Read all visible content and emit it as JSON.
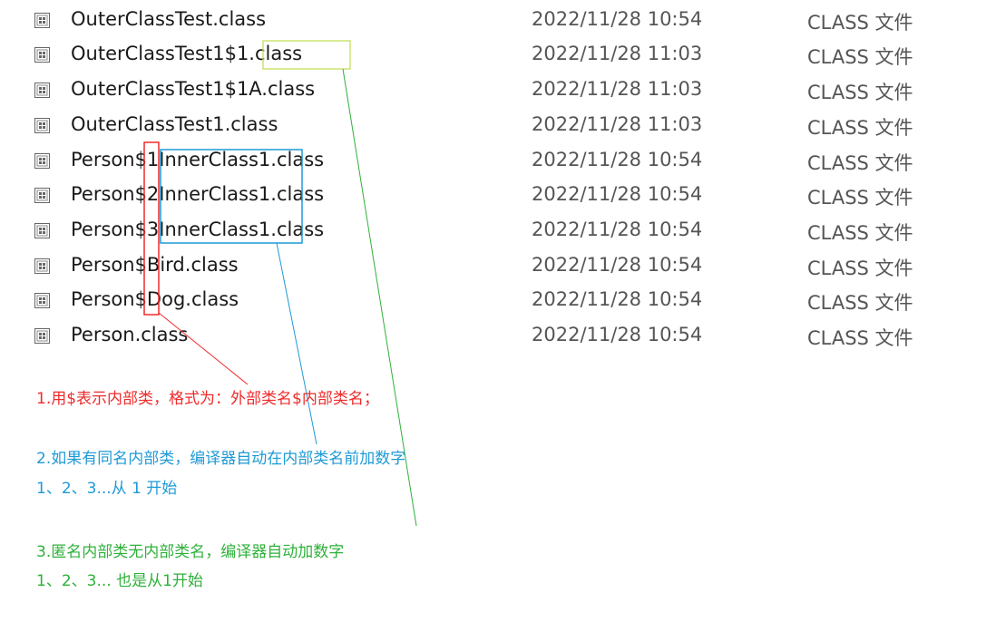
{
  "files": [
    {
      "name": "OuterClassTest.class",
      "date": "2022/11/28 10:54",
      "type": "CLASS 文件"
    },
    {
      "name": "OuterClassTest1$1.class",
      "date": "2022/11/28 11:03",
      "type": "CLASS 文件"
    },
    {
      "name": "OuterClassTest1$1A.class",
      "date": "2022/11/28 11:03",
      "type": "CLASS 文件"
    },
    {
      "name": "OuterClassTest1.class",
      "date": "2022/11/28 11:03",
      "type": "CLASS 文件"
    },
    {
      "name": "Person$1InnerClass1.class",
      "date": "2022/11/28 10:54",
      "type": "CLASS 文件"
    },
    {
      "name": "Person$2InnerClass1.class",
      "date": "2022/11/28 10:54",
      "type": "CLASS 文件"
    },
    {
      "name": "Person$3InnerClass1.class",
      "date": "2022/11/28 10:54",
      "type": "CLASS 文件"
    },
    {
      "name": "Person$Bird.class",
      "date": "2022/11/28 10:54",
      "type": "CLASS 文件"
    },
    {
      "name": "Person$Dog.class",
      "date": "2022/11/28 10:54",
      "type": "CLASS 文件"
    },
    {
      "name": "Person.class",
      "date": "2022/11/28 10:54",
      "type": "CLASS 文件"
    }
  ],
  "notes": {
    "note1": "1.用$表示内部类，格式为：外部类名$内部类名；",
    "note2_line1": "2.如果有同名内部类，编译器自动在内部类名前加数字",
    "note2_line2": "1、2、3...从 1 开始",
    "note3_line1": "3.匿名内部类无内部类名，编译器自动加数字",
    "note3_line2": "1、2、3... 也是从1开始"
  },
  "colors": {
    "red": "#ee2b2b",
    "blue": "#1e9ad6",
    "green": "#a8d84a",
    "green_line": "#2fb13a"
  }
}
